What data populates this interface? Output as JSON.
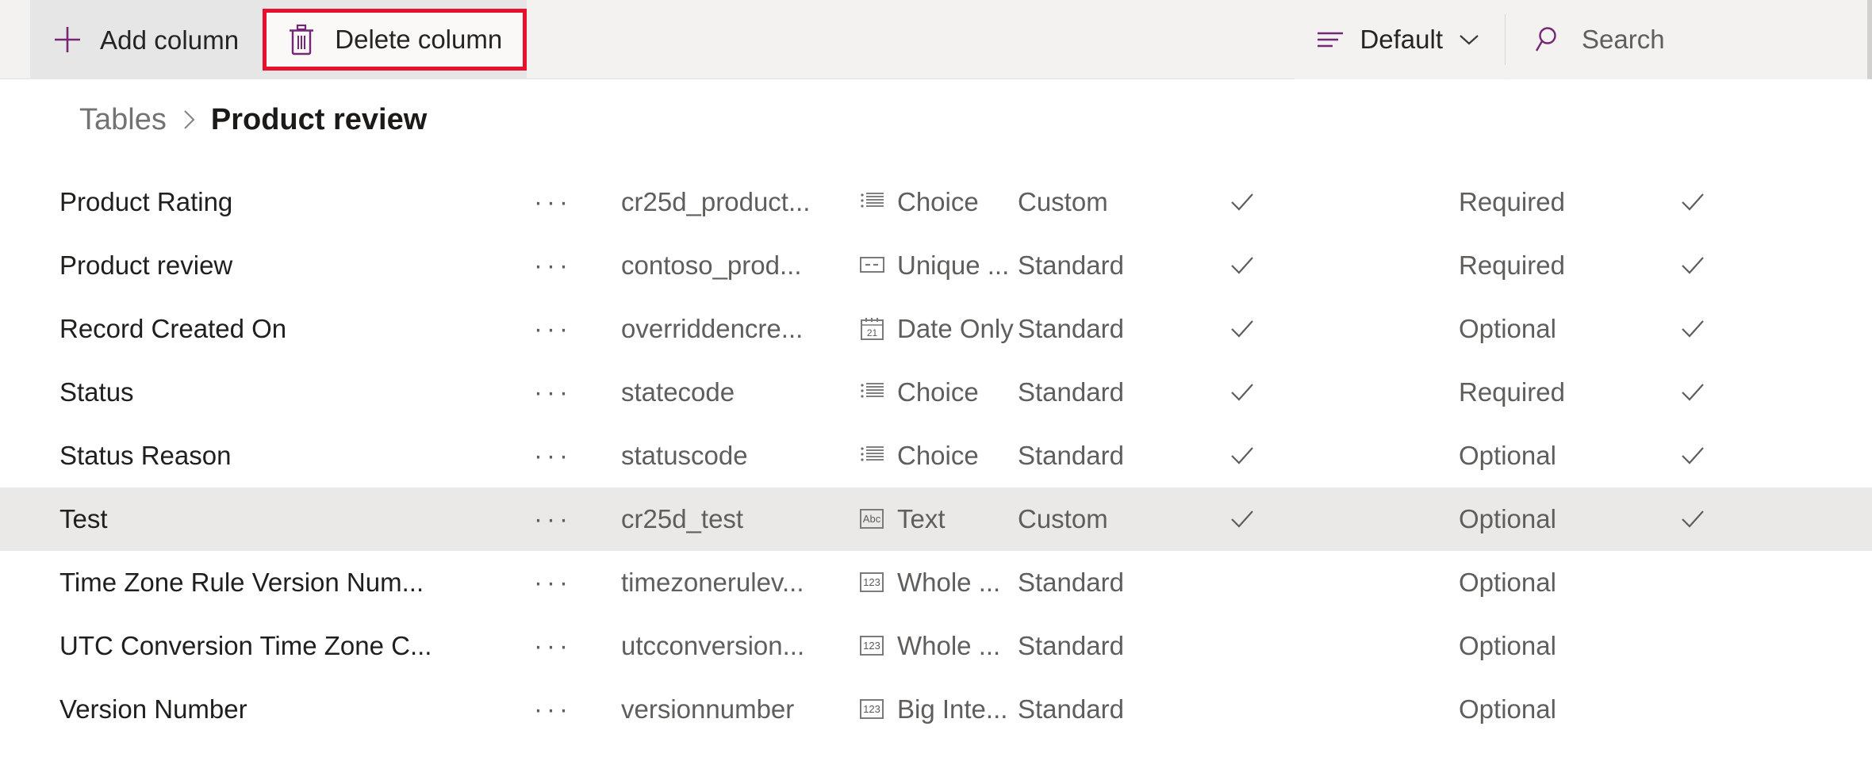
{
  "commandbar": {
    "add_column_label": "Add column",
    "delete_column_label": "Delete column",
    "view_label": "Default",
    "search_label": "Search",
    "highlight_color": "#e8112d",
    "accent_color": "#742774"
  },
  "breadcrumb": {
    "parent": "Tables",
    "separator": ">",
    "current": "Product review"
  },
  "grid": {
    "rows": [
      {
        "name": "Product Rating",
        "overflow": "···",
        "logical_name": "cr25d_product...",
        "data_type": "Choice",
        "type_icon": "choice-icon",
        "customization": "Custom",
        "searchable": true,
        "requirement": "Required",
        "second_check": true,
        "selected": false
      },
      {
        "name": "Product review",
        "overflow": "···",
        "logical_name": "contoso_prod...",
        "data_type": "Unique ...",
        "type_icon": "unique-id-icon",
        "customization": "Standard",
        "searchable": true,
        "requirement": "Required",
        "second_check": true,
        "selected": false
      },
      {
        "name": "Record Created On",
        "overflow": "···",
        "logical_name": "overriddencre...",
        "data_type": "Date Only",
        "type_icon": "date-only-icon",
        "customization": "Standard",
        "searchable": true,
        "requirement": "Optional",
        "second_check": true,
        "selected": false
      },
      {
        "name": "Status",
        "overflow": "···",
        "logical_name": "statecode",
        "data_type": "Choice",
        "type_icon": "choice-icon",
        "customization": "Standard",
        "searchable": true,
        "requirement": "Required",
        "second_check": true,
        "selected": false
      },
      {
        "name": "Status Reason",
        "overflow": "···",
        "logical_name": "statuscode",
        "data_type": "Choice",
        "type_icon": "choice-icon",
        "customization": "Standard",
        "searchable": true,
        "requirement": "Optional",
        "second_check": true,
        "selected": false
      },
      {
        "name": "Test",
        "overflow": "···",
        "logical_name": "cr25d_test",
        "data_type": "Text",
        "type_icon": "text-icon",
        "customization": "Custom",
        "searchable": true,
        "requirement": "Optional",
        "second_check": true,
        "selected": true
      },
      {
        "name": "Time Zone Rule Version Num...",
        "overflow": "···",
        "logical_name": "timezonerulev...",
        "data_type": "Whole ...",
        "type_icon": "whole-number-icon",
        "customization": "Standard",
        "searchable": false,
        "requirement": "Optional",
        "second_check": false,
        "selected": false
      },
      {
        "name": "UTC Conversion Time Zone C...",
        "overflow": "···",
        "logical_name": "utcconversion...",
        "data_type": "Whole ...",
        "type_icon": "whole-number-icon",
        "customization": "Standard",
        "searchable": false,
        "requirement": "Optional",
        "second_check": false,
        "selected": false
      },
      {
        "name": "Version Number",
        "overflow": "···",
        "logical_name": "versionnumber",
        "data_type": "Big Inte...",
        "type_icon": "big-integer-icon",
        "customization": "Standard",
        "searchable": false,
        "requirement": "Optional",
        "second_check": false,
        "selected": false
      }
    ]
  }
}
